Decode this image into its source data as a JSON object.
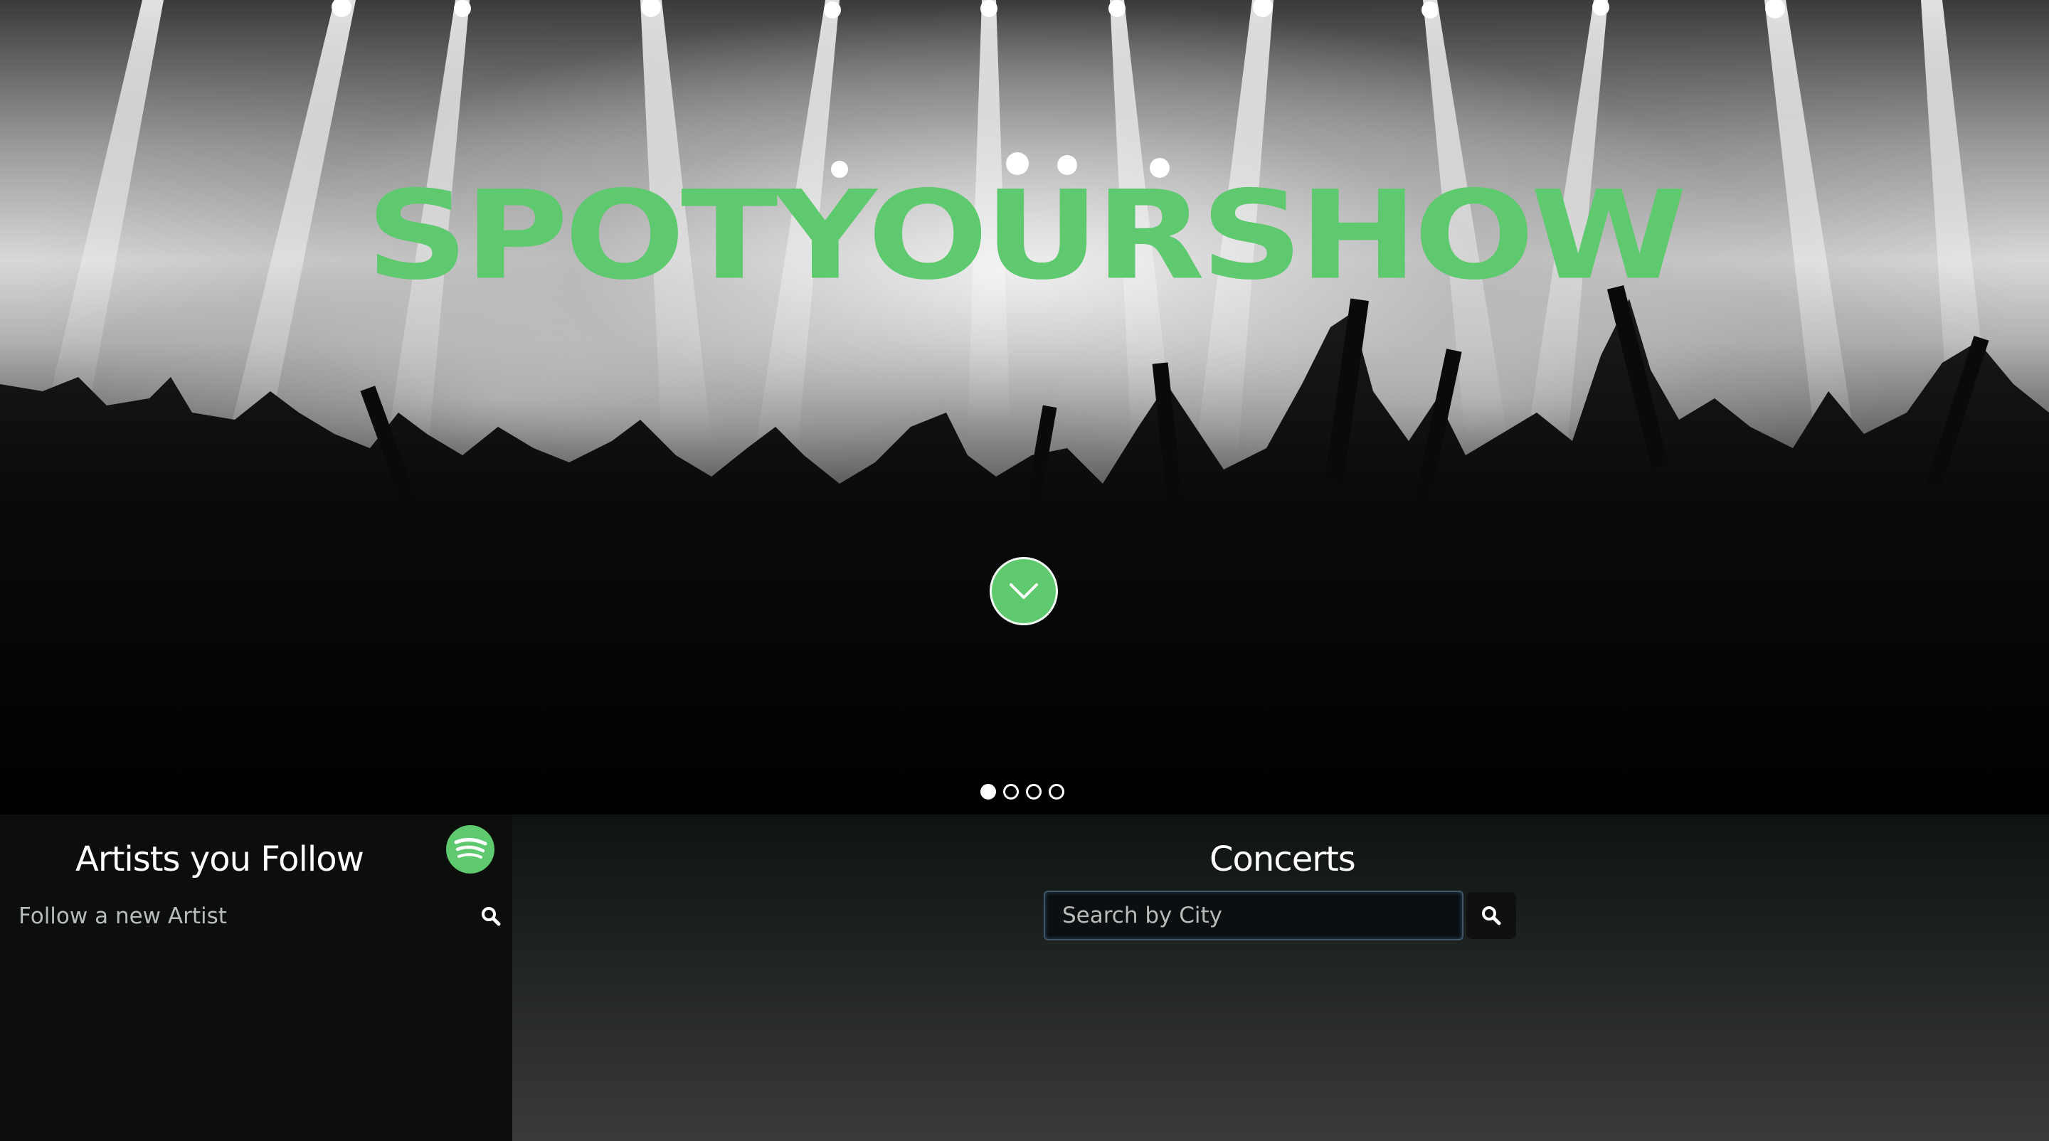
{
  "hero": {
    "logo_text": "SPOTYOURSHOW",
    "scroll_icon": "chevron-down-icon",
    "slides": [
      {
        "active": true
      },
      {
        "active": false
      },
      {
        "active": false
      },
      {
        "active": false
      }
    ]
  },
  "artists": {
    "title": "Artists you Follow",
    "brand_icon": "spotify-icon",
    "follow_placeholder": "Follow a new Artist",
    "search_icon": "search-icon"
  },
  "concerts": {
    "title": "Concerts",
    "city_placeholder": "Search by City",
    "search_icon": "search-icon"
  },
  "colors": {
    "accent": "#5ec96e",
    "panel_dark": "#0c0e0c",
    "input_border": "#3f5566"
  }
}
